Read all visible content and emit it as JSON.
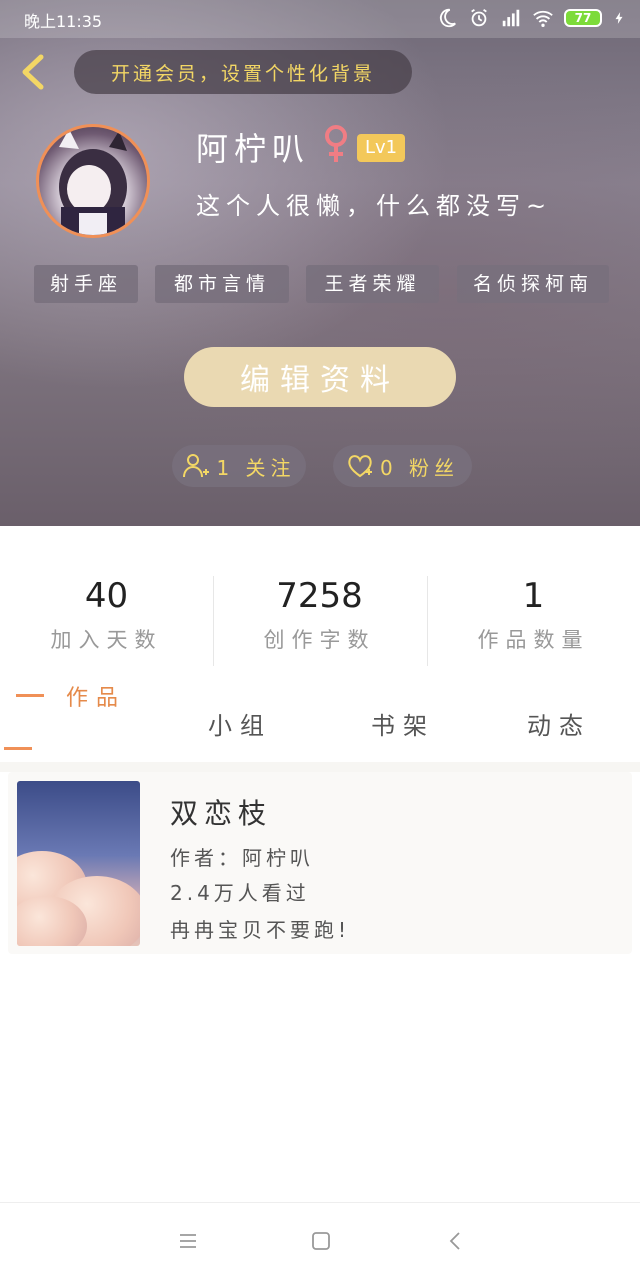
{
  "status": {
    "time": "晚上11:35",
    "battery": "77"
  },
  "header": {
    "vip_banner": "开通会员，设置个性化背景",
    "nickname": "阿柠叭",
    "gender_symbol": "♀",
    "level": "Lv1",
    "signature": "这个人很懒，什么都没写~",
    "tags": [
      "射手座",
      "都市言情",
      "王者荣耀",
      "名侦探柯南"
    ],
    "edit_button": "编辑资料",
    "following": "1 关注",
    "followers": "0 粉丝"
  },
  "stats": [
    {
      "value": "40",
      "label": "加入天数"
    },
    {
      "value": "7258",
      "label": "创作字数"
    },
    {
      "value": "1",
      "label": "作品数量"
    }
  ],
  "tabs": [
    "作品",
    "小组",
    "书架",
    "动态"
  ],
  "work": {
    "title": "双恋枝",
    "author": "作者：阿柠叭",
    "views": "2.4万人看过",
    "desc": "冉冉宝贝不要跑!"
  },
  "colors": {
    "accent": "#f09057",
    "gold": "#f3d765",
    "level_bg": "#f3c85a",
    "edit_bg": "#ead9b2"
  },
  "icons": [
    "back-arrow-icon",
    "moon-icon",
    "alarm-icon",
    "signal-icon",
    "wifi-icon",
    "charging-icon",
    "follow-person-icon",
    "heart-icon",
    "menu-icon",
    "home-square-icon",
    "back-triangle-icon"
  ]
}
